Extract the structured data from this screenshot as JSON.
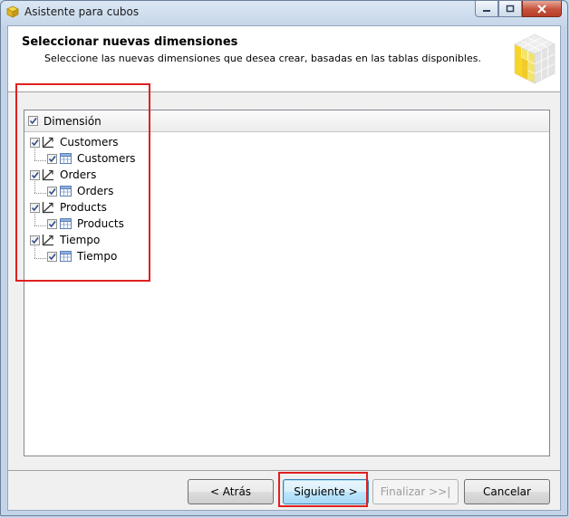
{
  "window": {
    "title": "Asistente para cubos"
  },
  "header": {
    "title": "Seleccionar nuevas dimensiones",
    "subtitle": "Seleccione las nuevas dimensiones que desea crear, basadas en las tablas disponibles."
  },
  "tree": {
    "column_header": "Dimensión",
    "items": [
      {
        "label": "Customers",
        "checked": true,
        "child": {
          "label": "Customers",
          "checked": true
        }
      },
      {
        "label": "Orders",
        "checked": true,
        "child": {
          "label": "Orders",
          "checked": true
        }
      },
      {
        "label": "Products",
        "checked": true,
        "child": {
          "label": "Products",
          "checked": true
        }
      },
      {
        "label": "Tiempo",
        "checked": true,
        "child": {
          "label": "Tiempo",
          "checked": true
        }
      }
    ]
  },
  "buttons": {
    "back": "< Atrás",
    "next": "Siguiente >",
    "finish": "Finalizar >>|",
    "cancel": "Cancelar"
  },
  "colors": {
    "highlight": "#e02020",
    "header_bg": "#ffffff",
    "dialog_bg": "#f0f0f0"
  }
}
